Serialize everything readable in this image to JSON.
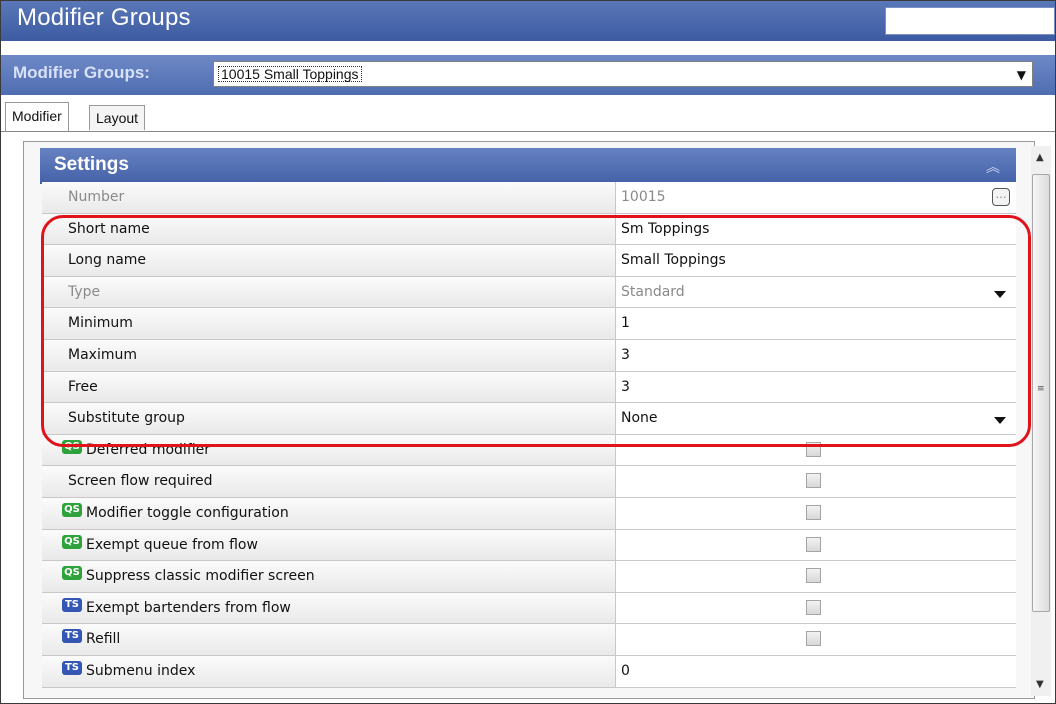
{
  "window": {
    "title": "Modifier Groups"
  },
  "group_selector": {
    "label": "Modifier Groups:",
    "value": "10015 Small Toppings"
  },
  "tabs": [
    {
      "label": "Modifier",
      "active": true
    },
    {
      "label": "Layout",
      "active": false
    }
  ],
  "settings": {
    "header": "Settings",
    "rows": [
      {
        "label": "Number",
        "value": "10015"
      },
      {
        "label": "Short name",
        "value": "Sm Toppings"
      },
      {
        "label": "Long name",
        "value": "Small Toppings"
      },
      {
        "label": "Type",
        "value": "Standard"
      },
      {
        "label": "Minimum",
        "value": "1"
      },
      {
        "label": "Maximum",
        "value": "3"
      },
      {
        "label": "Free",
        "value": "3"
      },
      {
        "label": "Substitute group",
        "value": "None"
      },
      {
        "label": "Deferred modifier"
      },
      {
        "label": "Screen flow required"
      },
      {
        "label": "Modifier toggle configuration"
      },
      {
        "label": "Exempt queue from flow"
      },
      {
        "label": "Suppress classic modifier screen"
      },
      {
        "label": "Exempt bartenders from flow"
      },
      {
        "label": "Refill"
      },
      {
        "label": "Submenu index",
        "value": "0"
      }
    ]
  },
  "badges": {
    "qs": "QS",
    "ts": "TS"
  },
  "colors": {
    "title_bar": "#3d5ba2",
    "highlight": "#e0131a",
    "qs_badge": "#2fa33b",
    "ts_badge": "#3457b3"
  }
}
